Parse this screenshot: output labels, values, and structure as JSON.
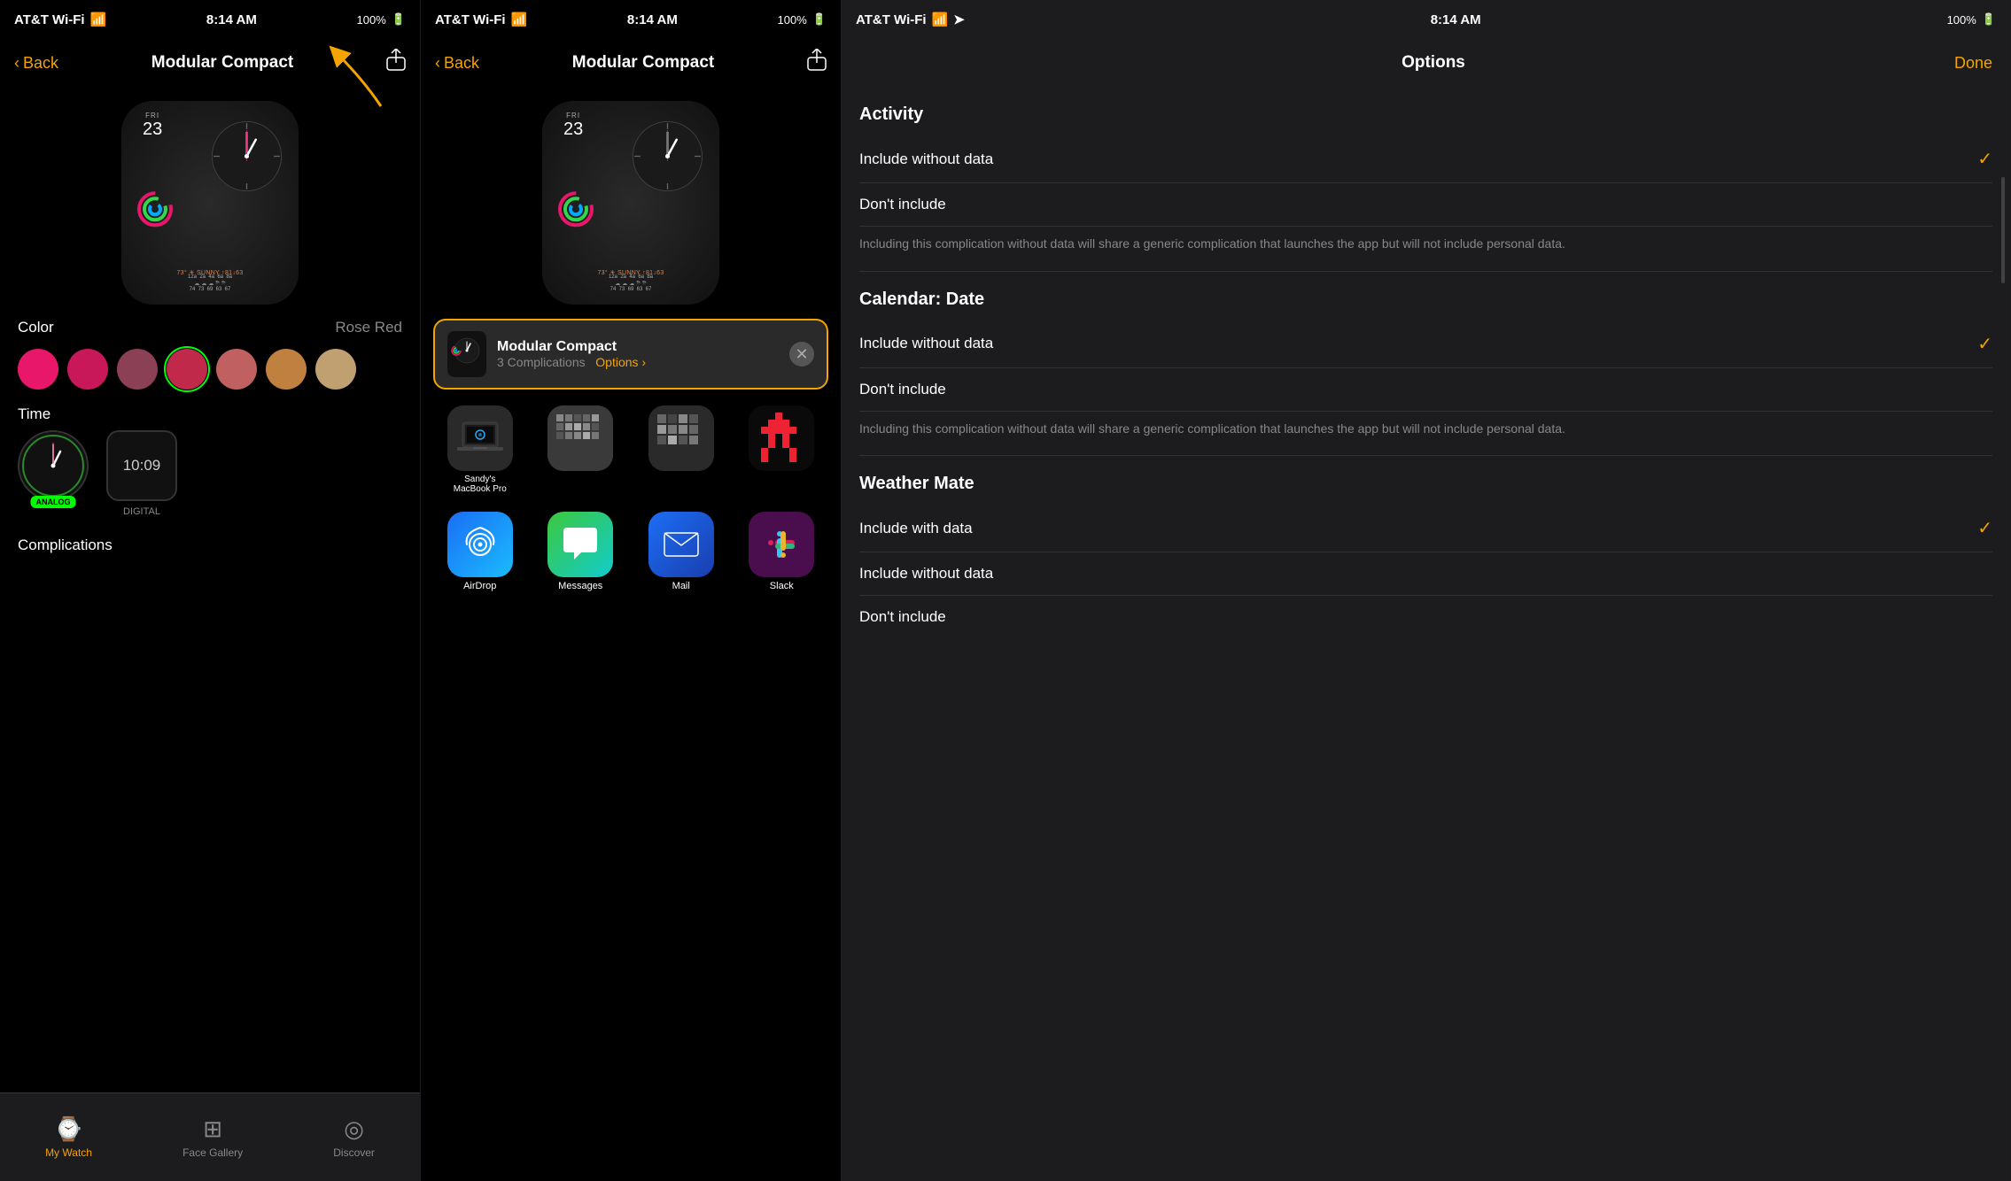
{
  "panel1": {
    "statusBar": {
      "carrier": "AT&T Wi-Fi",
      "time": "8:14 AM",
      "battery": "100%"
    },
    "navBar": {
      "back": "Back",
      "title": "Modular Compact",
      "shareIcon": "⬆"
    },
    "watchFace": {
      "day": "FRI",
      "date": "23",
      "weatherLine": "73° ☀ SUNNY ↑81↓63",
      "weatherTimes": "12a  2a  4a  6a  8a",
      "weatherTemps": "74  73  69  63  67"
    },
    "colorSection": {
      "label": "Color",
      "value": "Rose Red",
      "swatches": [
        {
          "color": "#e8176a",
          "selected": false
        },
        {
          "color": "#c8185a",
          "selected": false
        },
        {
          "color": "#8b4055",
          "selected": false
        },
        {
          "color": "#c0294a",
          "selected": true
        },
        {
          "color": "#c06060",
          "selected": false
        },
        {
          "color": "#c08040",
          "selected": false
        },
        {
          "color": "#c0a070",
          "selected": false
        }
      ]
    },
    "timeSection": {
      "label": "Time",
      "options": [
        {
          "type": "analog",
          "badge": "ANALOG"
        },
        {
          "type": "digital",
          "value": "10:09",
          "badge": "DIGITAL"
        }
      ]
    },
    "complicationsLabel": "Complications",
    "bottomNav": {
      "items": [
        {
          "icon": "⌚",
          "label": "My Watch",
          "active": true
        },
        {
          "icon": "⊞",
          "label": "Face Gallery",
          "active": false
        },
        {
          "icon": "◎",
          "label": "Discover",
          "active": false
        }
      ]
    }
  },
  "panel2": {
    "statusBar": {
      "carrier": "AT&T Wi-Fi",
      "time": "8:14 AM",
      "battery": "100%"
    },
    "navBar": {
      "back": "Back",
      "title": "Modular Compact",
      "shareIcon": "⬆"
    },
    "shareCard": {
      "title": "Modular Compact",
      "subtitle": "3 Complications",
      "optionsLink": "Options ›"
    },
    "apps": {
      "row1": [
        {
          "name": "Sandy's MacBook Pro",
          "label": "Sandy's\nMacBook Pro",
          "type": "mac"
        },
        {
          "name": "app2",
          "label": "",
          "type": "pattern1"
        },
        {
          "name": "app3",
          "label": "",
          "type": "pattern2"
        },
        {
          "name": "app4",
          "label": "",
          "type": "red-pixel"
        }
      ],
      "row2": [
        {
          "name": "AirDrop",
          "label": "AirDrop",
          "type": "blue"
        },
        {
          "name": "Messages",
          "label": "Messages",
          "type": "green"
        },
        {
          "name": "Mail",
          "label": "Mail",
          "type": "azure"
        },
        {
          "name": "Slack",
          "label": "Slack",
          "type": "slack"
        }
      ]
    }
  },
  "panel3": {
    "statusBar": {
      "carrier": "AT&T Wi-Fi",
      "time": "8:14 AM",
      "battery": "100%"
    },
    "header": {
      "title": "Options",
      "done": "Done"
    },
    "sections": [
      {
        "title": "Activity",
        "options": [
          {
            "label": "Include without data",
            "checked": true
          },
          {
            "label": "Don't include",
            "checked": false
          }
        ],
        "note": "Including this complication without data will share a generic complication that launches the app but will not include personal data."
      },
      {
        "title": "Calendar: Date",
        "options": [
          {
            "label": "Include without data",
            "checked": true
          },
          {
            "label": "Don't include",
            "checked": false
          }
        ],
        "note": "Including this complication without data will share a generic complication that launches the app but will not include personal data."
      },
      {
        "title": "Weather Mate",
        "options": [
          {
            "label": "Include with data",
            "checked": true
          },
          {
            "label": "Include without data",
            "checked": false
          },
          {
            "label": "Don't include",
            "checked": false
          }
        ],
        "note": ""
      }
    ]
  }
}
